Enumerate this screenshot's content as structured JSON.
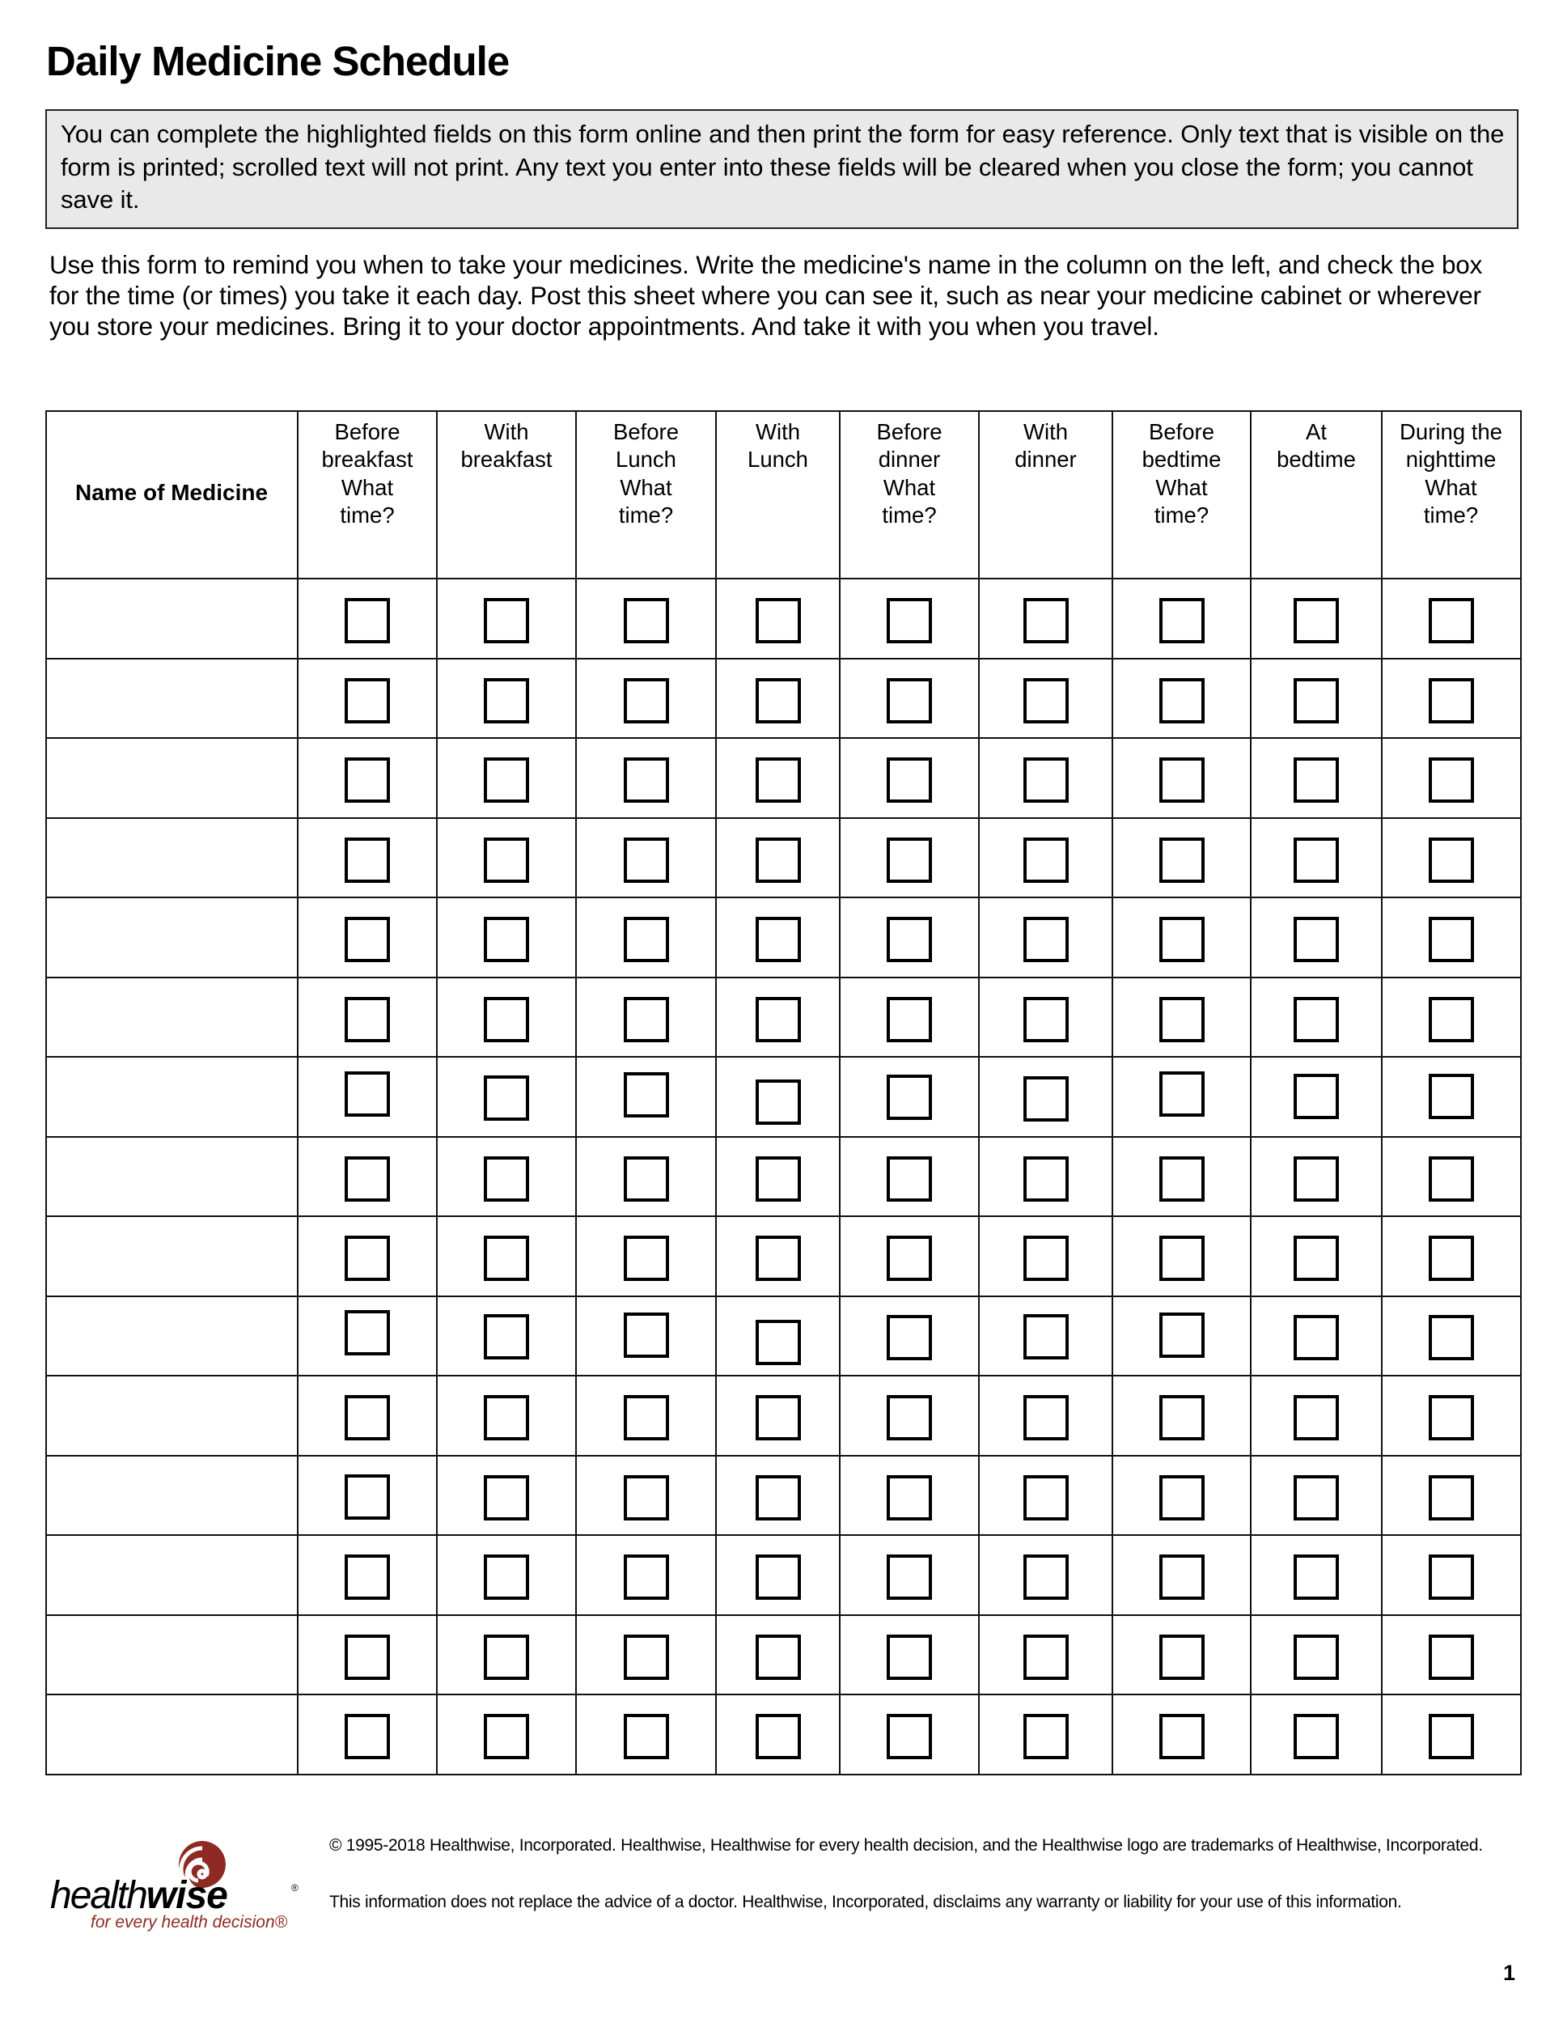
{
  "document": {
    "title": "Daily Medicine Schedule",
    "notice": "You can complete the highlighted fields on this form online and then print the form for easy reference. Only  text that is visible on the form is printed; scrolled text will not print. Any text you enter into these fields will  be cleared when you close the form; you cannot save it.",
    "intro": "Use this form to remind you when to take your medicines. Write the medicine's name in the column on the  left, and check the box for the time (or times) you take it each day. Post this sheet where you can see it,  such as near your medicine cabinet or wherever you store your medicines. Bring it to your doctor  appointments. And take it with you when you travel."
  },
  "schedule": {
    "name_header": "Name of Medicine",
    "columns": [
      {
        "line1": "Before",
        "line2": "breakfast",
        "sub1": "What",
        "sub2": "time?"
      },
      {
        "line1": "With",
        "line2": "breakfast",
        "sub1": "",
        "sub2": ""
      },
      {
        "line1": "Before",
        "line2": "Lunch",
        "sub1": "What",
        "sub2": "time?"
      },
      {
        "line1": "With",
        "line2": "Lunch",
        "sub1": "",
        "sub2": ""
      },
      {
        "line1": "Before",
        "line2": "dinner",
        "sub1": "What",
        "sub2": "time?"
      },
      {
        "line1": "With",
        "line2": "dinner",
        "sub1": "",
        "sub2": ""
      },
      {
        "line1": "Before",
        "line2": "bedtime",
        "sub1": "What",
        "sub2": "time?"
      },
      {
        "line1": "At",
        "line2": "bedtime",
        "sub1": "",
        "sub2": ""
      },
      {
        "line1": "During the",
        "line2": "nighttime",
        "sub1": "What",
        "sub2": "time?"
      }
    ],
    "rows": [
      {
        "medicine": "",
        "checked": [
          false,
          false,
          false,
          false,
          false,
          false,
          false,
          false,
          false
        ]
      },
      {
        "medicine": "",
        "checked": [
          false,
          false,
          false,
          false,
          false,
          false,
          false,
          false,
          false
        ]
      },
      {
        "medicine": "",
        "checked": [
          false,
          false,
          false,
          false,
          false,
          false,
          false,
          false,
          false
        ]
      },
      {
        "medicine": "",
        "checked": [
          false,
          false,
          false,
          false,
          false,
          false,
          false,
          false,
          false
        ]
      },
      {
        "medicine": "",
        "checked": [
          false,
          false,
          false,
          false,
          false,
          false,
          false,
          false,
          false
        ]
      },
      {
        "medicine": "",
        "checked": [
          false,
          false,
          false,
          false,
          false,
          false,
          false,
          false,
          false
        ]
      },
      {
        "medicine": "",
        "checked": [
          false,
          false,
          false,
          false,
          false,
          false,
          false,
          false,
          false
        ]
      },
      {
        "medicine": "",
        "checked": [
          false,
          false,
          false,
          false,
          false,
          false,
          false,
          false,
          false
        ]
      },
      {
        "medicine": "",
        "checked": [
          false,
          false,
          false,
          false,
          false,
          false,
          false,
          false,
          false
        ]
      },
      {
        "medicine": "",
        "checked": [
          false,
          false,
          false,
          false,
          false,
          false,
          false,
          false,
          false
        ]
      },
      {
        "medicine": "",
        "checked": [
          false,
          false,
          false,
          false,
          false,
          false,
          false,
          false,
          false
        ]
      },
      {
        "medicine": "",
        "checked": [
          false,
          false,
          false,
          false,
          false,
          false,
          false,
          false,
          false
        ]
      },
      {
        "medicine": "",
        "checked": [
          false,
          false,
          false,
          false,
          false,
          false,
          false,
          false,
          false
        ]
      },
      {
        "medicine": "",
        "checked": [
          false,
          false,
          false,
          false,
          false,
          false,
          false,
          false,
          false
        ]
      },
      {
        "medicine": "",
        "checked": [
          false,
          false,
          false,
          false,
          false,
          false,
          false,
          false,
          false
        ]
      }
    ]
  },
  "footer": {
    "logo": {
      "word_regular": "health",
      "word_bold": "wise",
      "registered_mark": "®",
      "tagline": "for every health decision®",
      "brand_color": "#8e2a23",
      "icon": "spiral-icon"
    },
    "copyright": "© 1995-2018 Healthwise, Incorporated. Healthwise, Healthwise for every health decision, and the Healthwise logo are trademarks of Healthwise, Incorporated.",
    "disclaimer": "This information does not replace the advice of a doctor. Healthwise, Incorporated, disclaims any warranty or liability for your use of this information.",
    "page_number": "1"
  }
}
